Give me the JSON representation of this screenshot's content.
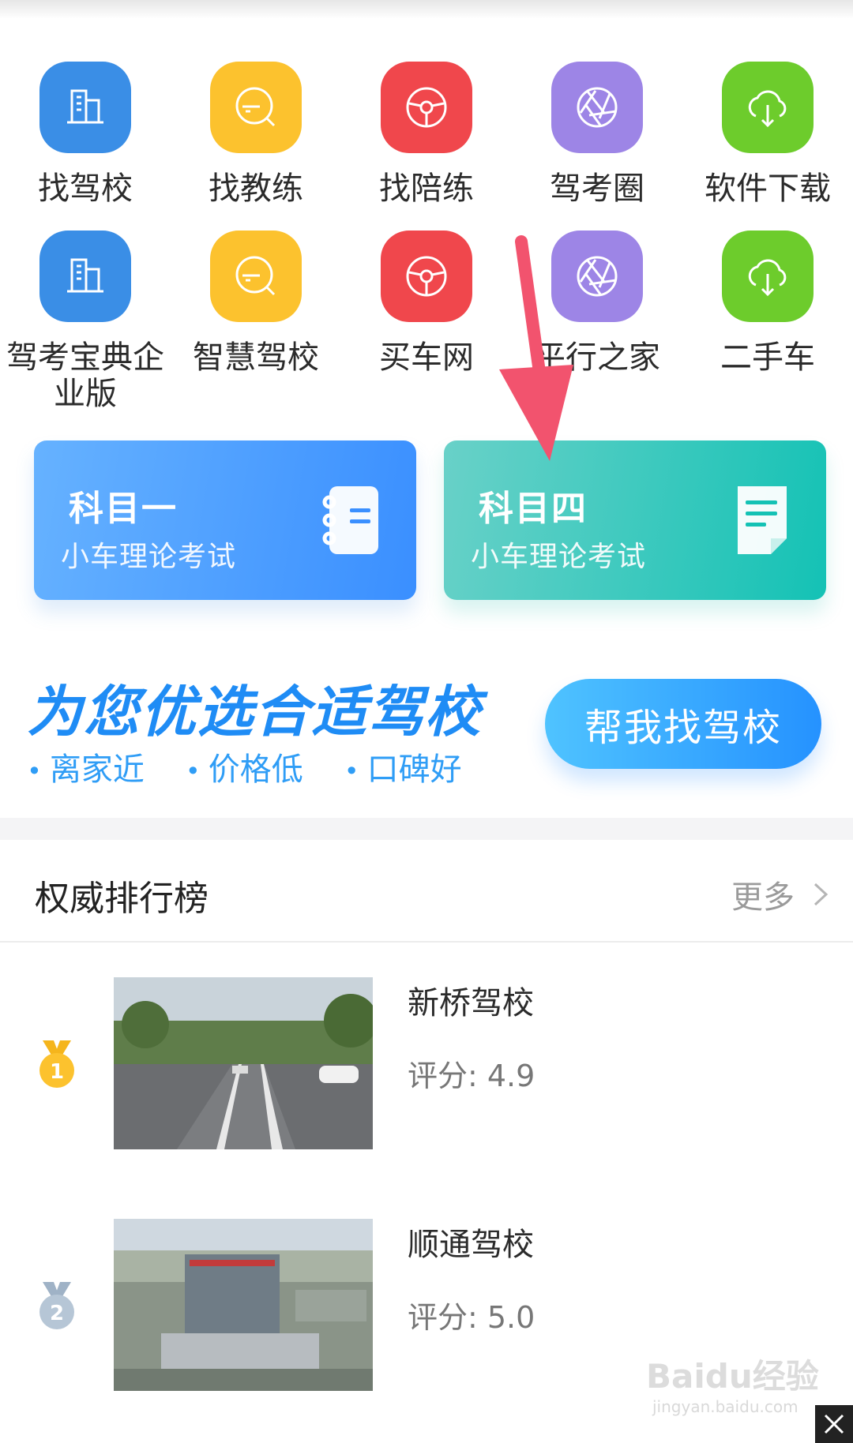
{
  "grid": {
    "row1": [
      {
        "label": "找驾校",
        "icon": "building-icon",
        "color": "#3a8ee6"
      },
      {
        "label": "找教练",
        "icon": "car-search-icon",
        "color": "#fcc22e"
      },
      {
        "label": "找陪练",
        "icon": "steering-wheel-icon",
        "color": "#f0474c"
      },
      {
        "label": "驾考圈",
        "icon": "aperture-icon",
        "color": "#9d85e6"
      },
      {
        "label": "软件下载",
        "icon": "cloud-download-icon",
        "color": "#6dcc2c"
      }
    ],
    "row2": [
      {
        "label": "驾考宝典企业版",
        "icon": "building-icon",
        "color": "#3a8ee6"
      },
      {
        "label": "智慧驾校",
        "icon": "car-search-icon",
        "color": "#fcc22e"
      },
      {
        "label": "买车网",
        "icon": "steering-wheel-icon",
        "color": "#f0474c"
      },
      {
        "label": "平行之家",
        "icon": "aperture-icon",
        "color": "#9d85e6"
      },
      {
        "label": "二手车",
        "icon": "cloud-download-icon",
        "color": "#6dcc2c"
      }
    ]
  },
  "subjects": {
    "one": {
      "title": "科目一",
      "subtitle": "小车理论考试",
      "icon": "notebook-icon"
    },
    "four": {
      "title": "科目四",
      "subtitle": "小车理论考试",
      "icon": "document-icon"
    }
  },
  "promo": {
    "title": "为您优选合适驾校",
    "tags": [
      "离家近",
      "价格低",
      "口碑好"
    ],
    "button": "帮我找驾校"
  },
  "ranking": {
    "title": "权威排行榜",
    "more": "更多",
    "items": [
      {
        "rank": "1",
        "name": "新桥驾校",
        "score": "评分: 4.9",
        "medal": "gold-medal-icon"
      },
      {
        "rank": "2",
        "name": "顺通驾校",
        "score": "评分: 5.0",
        "medal": "silver-medal-icon"
      }
    ]
  },
  "watermark": {
    "text": "Baidu经验",
    "sub": "jingyan.baidu.com"
  }
}
